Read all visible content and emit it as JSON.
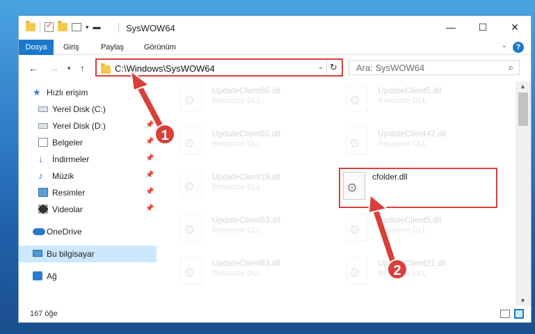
{
  "window": {
    "title": "SysWOW64",
    "controls": {
      "minimize": "—",
      "maximize": "☐",
      "close": "✕"
    }
  },
  "ribbon": {
    "tabs": [
      "Dosya",
      "Giriş",
      "Paylaş",
      "Görünüm"
    ],
    "help": "?"
  },
  "address": {
    "path": "C:\\Windows\\SysWOW64",
    "search_placeholder": "Ara: SysWOW64"
  },
  "sidebar": {
    "items": [
      {
        "label": "Hızlı erişim",
        "icon": "star-icon",
        "root": true,
        "pinned": false
      },
      {
        "label": "Yerel Disk (C:)",
        "icon": "drive-icon",
        "root": false,
        "pinned": true
      },
      {
        "label": "Yerel Disk (D:)",
        "icon": "drive-icon",
        "root": false,
        "pinned": true
      },
      {
        "label": "Belgeler",
        "icon": "documents-icon",
        "root": false,
        "pinned": true
      },
      {
        "label": "İndirmeler",
        "icon": "downloads-icon",
        "root": false,
        "pinned": true
      },
      {
        "label": "Müzik",
        "icon": "music-icon",
        "root": false,
        "pinned": true
      },
      {
        "label": "Resimler",
        "icon": "pictures-icon",
        "root": false,
        "pinned": true
      },
      {
        "label": "Videolar",
        "icon": "videos-icon",
        "root": false,
        "pinned": true
      },
      {
        "label": "OneDrive",
        "icon": "onedrive-icon",
        "root": true,
        "pinned": false
      },
      {
        "label": "Bu bilgisayar",
        "icon": "this-pc-icon",
        "root": true,
        "pinned": false,
        "selected": true
      },
      {
        "label": "Ağ",
        "icon": "network-icon",
        "root": true,
        "pinned": false
      }
    ]
  },
  "files": [
    {
      "name": "UpdateClient65.dll",
      "type": "Resource DLL",
      "faded": true
    },
    {
      "name": "UpdateClient5.dll",
      "type": "Resource DLL",
      "faded": true
    },
    {
      "name": "UpdateClient65.dll",
      "type": "Resource DLL",
      "faded": true
    },
    {
      "name": "UpdateClient42.dll",
      "type": "Resource DLL",
      "faded": true
    },
    {
      "name": "UpdateClient19.dll",
      "type": "Resource DLL",
      "faded": true
    },
    {
      "name": "cfolder.dll",
      "type": "",
      "faded": false,
      "highlight": true
    },
    {
      "name": "UpdateClient63.dll",
      "type": "Resource DLL",
      "faded": true
    },
    {
      "name": "UpdateClient5.dll",
      "type": "Resource DLL",
      "faded": true
    },
    {
      "name": "UpdateClient63.dll",
      "type": "Resource DLL",
      "faded": true
    },
    {
      "name": "UpdateClient21.dll",
      "type": "Resource DLL",
      "faded": true
    }
  ],
  "status": {
    "item_count": "167 öğe"
  },
  "annotations": {
    "step1": "1",
    "step2": "2",
    "color": "#d9403a"
  }
}
